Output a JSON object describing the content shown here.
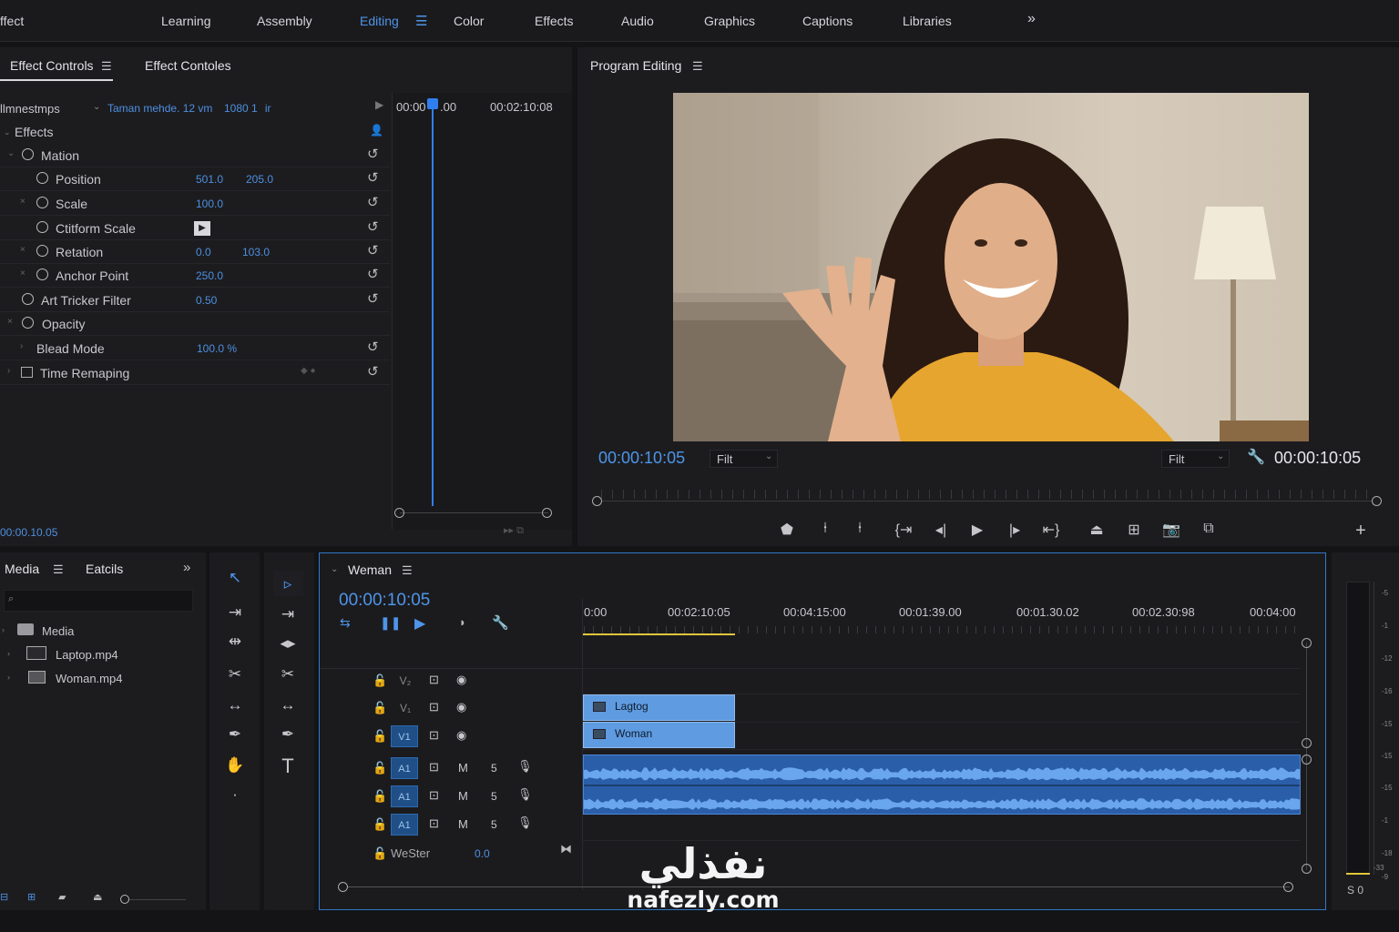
{
  "app": {
    "title_fragment": "ffect"
  },
  "workspaces": [
    {
      "label": "Learning"
    },
    {
      "label": "Assembly"
    },
    {
      "label": "Editing"
    },
    {
      "label": "Color"
    },
    {
      "label": "Effects"
    },
    {
      "label": "Audio"
    },
    {
      "label": "Graphics"
    },
    {
      "label": "Captions"
    },
    {
      "label": "Libraries"
    }
  ],
  "workspace_active": "Editing",
  "workspace_more": "»",
  "effect_panel": {
    "tab1": "Effect Controls",
    "tab2": "Effect Contoles",
    "source_label": "llmnestmps",
    "clip_info": "Taman mehde. 12 vm",
    "clip_res": "1080 1   ir",
    "time_start": "00:00",
    "time_start_suffix": ".00",
    "time_end": "00:02:10:08",
    "effects_header": "Effects",
    "current_time": "00:00.10.05",
    "rows": [
      {
        "label": "Mation"
      },
      {
        "label": "Position",
        "v1": "501.0",
        "v2": "205.0"
      },
      {
        "label": "Scale",
        "v1": "100.0"
      },
      {
        "label": "Ctitform Scale"
      },
      {
        "label": "Retation",
        "v1": "0.0",
        "v2": "103.0"
      },
      {
        "label": "Anchor Point",
        "v1": "250.0"
      },
      {
        "label": "Art Tricker Filter",
        "v1": "0.50"
      },
      {
        "label": "Opacity"
      },
      {
        "label": "Blead Mode",
        "v1": "100.0 %"
      },
      {
        "label": "Time Remaping"
      }
    ]
  },
  "program": {
    "title": "Program Editing",
    "timecode_left": "00:00:10:05",
    "fit_left": "Filt",
    "fit_right": "Filt",
    "timecode_right": "00:00:10:05"
  },
  "media": {
    "tab1": "Media",
    "tab2": "Eatcils",
    "folder": "Media",
    "items": [
      {
        "name": "Laptop.mp4"
      },
      {
        "name": "Woman.mp4"
      }
    ]
  },
  "timeline": {
    "sequence": "Weman",
    "timecode": "00:00:10:05",
    "ruler": [
      "0:00",
      "00:02:10:05",
      "00:04:15:00",
      "00:01:39.00",
      "00:01.30.02",
      "00:02.30:98",
      "00:04:00"
    ],
    "tracks": [
      {
        "name": "V₂"
      },
      {
        "name": "V₁"
      },
      {
        "name": "V1"
      },
      {
        "name": "A1"
      },
      {
        "name": "A1"
      },
      {
        "name": "A1"
      }
    ],
    "track_m": "M",
    "track_s": "5",
    "clips": [
      {
        "name": "Lagtog"
      },
      {
        "name": "Woman"
      }
    ],
    "master_label": "WeSter",
    "master_value": "0.0"
  },
  "meter": {
    "ticks": [
      "-5",
      "-1",
      "-12",
      "-16",
      "-15",
      "-15",
      "-15",
      "-1",
      "-18",
      "-33",
      "-9"
    ],
    "footer": "S 0"
  },
  "watermark": {
    "arabic": "نفذلي",
    "latin": "nafezly.com"
  },
  "colors": {
    "accent": "#4e95e8",
    "clip": "#5f9be0",
    "waveform": "#4a86d8",
    "playhead": "#2f7ff0"
  }
}
